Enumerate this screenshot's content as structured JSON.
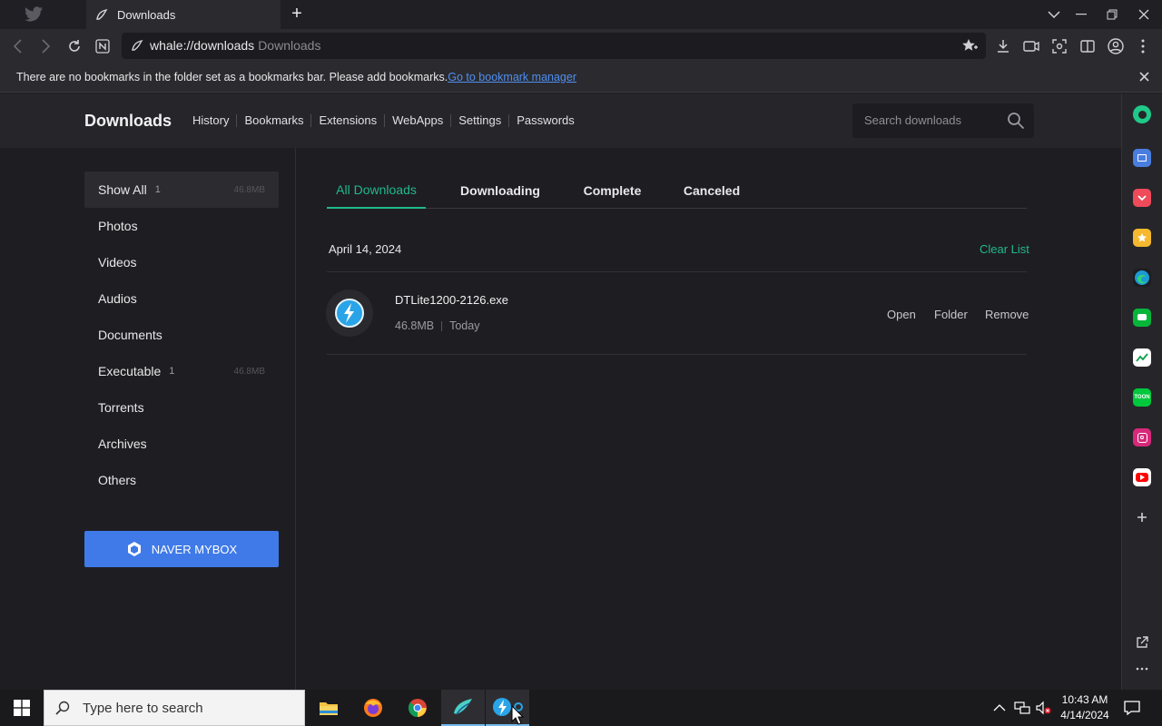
{
  "browser": {
    "tabs": [
      {
        "label": "",
        "icon": "twitter-bird-icon",
        "active": false
      },
      {
        "label": "Downloads",
        "icon": "whale-icon",
        "active": true
      }
    ],
    "address": {
      "url": "whale://downloads",
      "page_label": "Downloads"
    },
    "bookmarks_bar": {
      "message": "There are no bookmarks in the folder set as a bookmarks bar. Please add bookmarks.",
      "link": "Go to bookmark manager"
    }
  },
  "page": {
    "title": "Downloads",
    "top_nav": [
      "History",
      "Bookmarks",
      "Extensions",
      "WebApps",
      "Settings",
      "Passwords"
    ],
    "search_placeholder": "Search downloads",
    "sidebar": [
      {
        "label": "Show All",
        "count": "1",
        "size": "46.8MB",
        "active": true
      },
      {
        "label": "Photos",
        "count": "",
        "size": "",
        "active": false
      },
      {
        "label": "Videos",
        "count": "",
        "size": "",
        "active": false
      },
      {
        "label": "Audios",
        "count": "",
        "size": "",
        "active": false
      },
      {
        "label": "Documents",
        "count": "",
        "size": "",
        "active": false
      },
      {
        "label": "Executable",
        "count": "1",
        "size": "46.8MB",
        "active": false
      },
      {
        "label": "Torrents",
        "count": "",
        "size": "",
        "active": false
      },
      {
        "label": "Archives",
        "count": "",
        "size": "",
        "active": false
      },
      {
        "label": "Others",
        "count": "",
        "size": "",
        "active": false
      }
    ],
    "mybox_label": "NAVER MYBOX",
    "filter_tabs": [
      "All Downloads",
      "Downloading",
      "Complete",
      "Canceled"
    ],
    "active_filter": "All Downloads",
    "date_group": "April 14, 2024",
    "clear_list": "Clear List",
    "downloads": [
      {
        "name": "DTLite1200-2126.exe",
        "size": "46.8MB",
        "when": "Today",
        "actions": [
          "Open",
          "Folder",
          "Remove"
        ]
      }
    ]
  },
  "taskbar": {
    "search_placeholder": "Type here to search",
    "apps": [
      "file-explorer-icon",
      "firefox-icon",
      "chrome-icon",
      "whale-icon",
      "daemon-tools-icon"
    ],
    "time": "10:43 AM",
    "date": "4/14/2024"
  },
  "colors": {
    "accent": "#20b88c",
    "mybox": "#3f7ae8",
    "link": "#4f8ff0"
  }
}
